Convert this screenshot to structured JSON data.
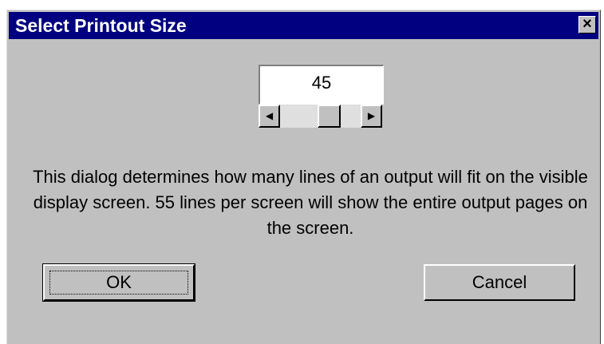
{
  "window": {
    "title": "Select Printout Size",
    "close_glyph": "×"
  },
  "size_control": {
    "value": "45",
    "left_arrow_glyph": "◀",
    "right_arrow_glyph": "▶"
  },
  "description": "This dialog determines how many lines of an output will fit on the visible display screen.  55 lines per screen will show the entire output pages on the screen.",
  "buttons": {
    "ok_label": "OK",
    "cancel_label": "Cancel"
  },
  "colors": {
    "titlebar": "#000080",
    "face": "#c0c0c0"
  },
  "icons": [
    "close-icon",
    "scroll-left-arrow-icon",
    "scroll-right-arrow-icon"
  ]
}
